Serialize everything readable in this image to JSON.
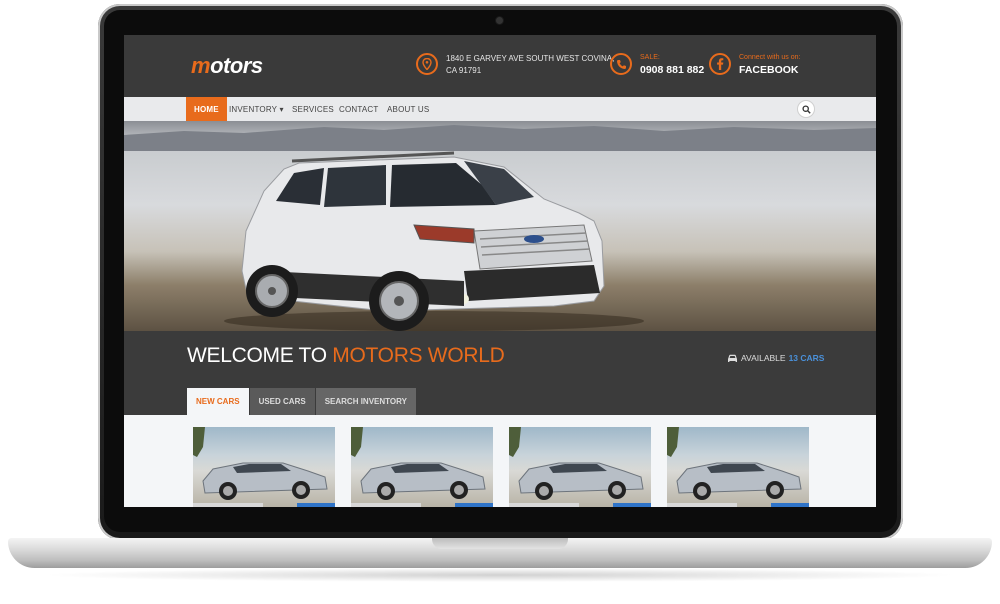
{
  "site": {
    "logo_prefix": "m",
    "logo_rest": "otors"
  },
  "contact": {
    "address_line1": "1840 E GARVEY AVE SOUTH WEST COVINA,",
    "address_line2": "CA 91791",
    "sale_label": "SALE:",
    "sale_phone": "0908 881 882",
    "connect_label": "Connect with us on:",
    "connect_network": "FACEBOOK",
    "icons": [
      "map-pin-icon",
      "phone-icon",
      "facebook-icon"
    ]
  },
  "nav": {
    "items": [
      {
        "label": "HOME",
        "active": true
      },
      {
        "label": "INVENTORY ▾",
        "active": false
      },
      {
        "label": "SERVICES",
        "active": false
      },
      {
        "label": "CONTACT",
        "active": false
      },
      {
        "label": "ABOUT US",
        "active": false
      }
    ],
    "search_icon": "search-icon"
  },
  "welcome": {
    "text_prefix": "WELCOME TO ",
    "text_highlight": "MOTORS WORLD",
    "available_label": "AVAILABLE",
    "available_count": "13 CARS",
    "car_icon": "car-icon"
  },
  "tabs": [
    {
      "label": "NEW CARS",
      "active": true
    },
    {
      "label": "USED CARS",
      "active": false
    },
    {
      "label": "SEARCH INVENTORY",
      "active": false
    }
  ],
  "colors": {
    "accent": "#e86b1c",
    "header_bg": "#3a3a3a",
    "link_blue": "#4a90d9"
  }
}
